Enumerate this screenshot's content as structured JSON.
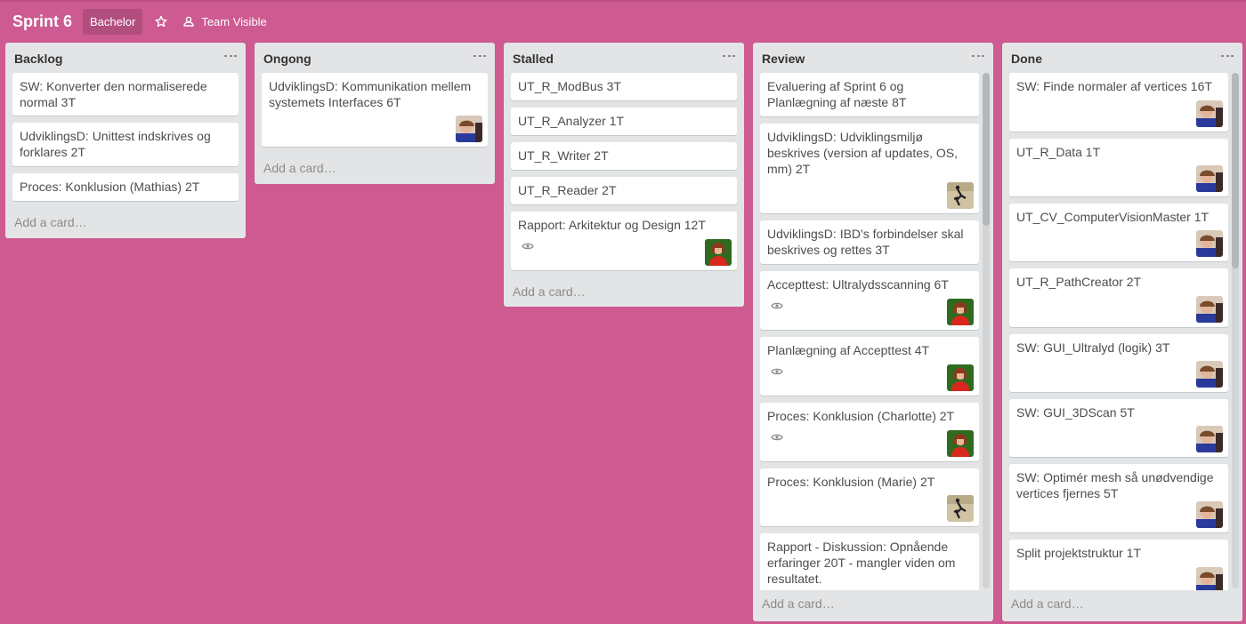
{
  "board": {
    "title": "Sprint 6",
    "org_label": "Bachelor",
    "team_label": "Team Visible",
    "background_color": "#cd5a91"
  },
  "lists": [
    {
      "title": "Backlog",
      "add_label": "Add a card…",
      "cards": [
        {
          "text": "SW: Konverter den normaliserede normal 3T"
        },
        {
          "text": "UdviklingsD: Unittest indskrives og forklares 2T"
        },
        {
          "text": "Proces: Konklusion (Mathias) 2T"
        }
      ]
    },
    {
      "title": "Ongong",
      "add_label": "Add a card…",
      "cards": [
        {
          "text": "UdviklingsD: Kommunikation mellem systemets Interfaces 6T",
          "avatar": "duo"
        }
      ]
    },
    {
      "title": "Stalled",
      "add_label": "Add a card…",
      "cards": [
        {
          "text": "UT_R_ModBus 3T"
        },
        {
          "text": "UT_R_Analyzer 1T"
        },
        {
          "text": "UT_R_Writer 2T"
        },
        {
          "text": "UT_R_Reader 2T"
        },
        {
          "text": "Rapport: Arkitektur og Design 12T",
          "watch": true,
          "avatar": "red"
        }
      ]
    },
    {
      "title": "Review",
      "add_label": "Add a card…",
      "cards": [
        {
          "text": "Evaluering af Sprint 6 og Planlægning af næste 8T"
        },
        {
          "text": "UdviklingsD: Udviklingsmiljø beskrives (version af updates, OS, mm) 2T",
          "avatar": "tan"
        },
        {
          "text": "UdviklingsD: IBD's forbindelser skal beskrives og rettes 3T"
        },
        {
          "text": "Accepttest: Ultralydsscanning 6T",
          "watch": true,
          "avatar": "red"
        },
        {
          "text": "Planlægning af Accepttest 4T",
          "watch": true,
          "avatar": "red"
        },
        {
          "text": "Proces: Konklusion (Charlotte) 2T",
          "watch": true,
          "avatar": "red"
        },
        {
          "text": "Proces: Konklusion (Marie) 2T",
          "avatar": "tan"
        },
        {
          "text": "Rapport - Diskussion: Opnående erfaringer 20T - mangler viden om resultatet.",
          "avatar": "tan"
        }
      ]
    },
    {
      "title": "Done",
      "add_label": "Add a card…",
      "cards": [
        {
          "text": "SW: Finde normaler af vertices 16T",
          "avatar": "duo"
        },
        {
          "text": "UT_R_Data 1T",
          "avatar": "duo"
        },
        {
          "text": "UT_CV_ComputerVisionMaster 1T",
          "avatar": "duo"
        },
        {
          "text": "UT_R_PathCreator 2T",
          "avatar": "duo"
        },
        {
          "text": "SW: GUI_Ultralyd (logik) 3T",
          "avatar": "duo"
        },
        {
          "text": "SW: GUI_3DScan 5T",
          "avatar": "duo"
        },
        {
          "text": "SW: Optimér mesh så unødvendige vertices fjernes 5T",
          "avatar": "duo"
        },
        {
          "text": "Split projektstruktur 1T",
          "avatar": "duo"
        }
      ]
    }
  ]
}
